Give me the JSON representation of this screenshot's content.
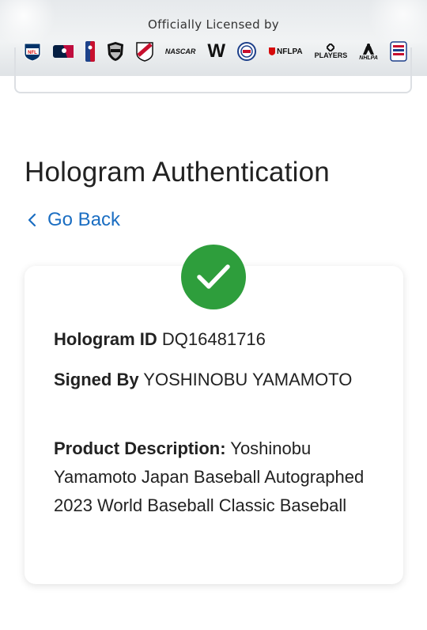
{
  "banner": {
    "title": "Officially Licensed by",
    "logos": [
      {
        "name": "nfl-logo",
        "label": "NFL"
      },
      {
        "name": "mlb-logo",
        "label": ""
      },
      {
        "name": "nba-logo",
        "label": ""
      },
      {
        "name": "nhl-logo",
        "label": ""
      },
      {
        "name": "mls-logo",
        "label": ""
      },
      {
        "name": "nascar-logo",
        "label": "NASCAR"
      },
      {
        "name": "wwe-logo",
        "label": "W"
      },
      {
        "name": "usa-logo",
        "label": ""
      },
      {
        "name": "nflpa-logo",
        "label": "NFLPA"
      },
      {
        "name": "players-logo",
        "label": "PLAYERS"
      },
      {
        "name": "nhlpa-logo",
        "label": "NHLPA"
      },
      {
        "name": "hof-logo",
        "label": ""
      }
    ]
  },
  "page": {
    "title": "Hologram Authentication",
    "back_label": "Go Back"
  },
  "result": {
    "status_icon": "check-icon",
    "status_color": "#2e9e3c",
    "hologram_label": "Hologram ID",
    "hologram_value": "DQ16481716",
    "signed_label": "Signed By",
    "signed_value": "YOSHINOBU YAMAMOTO",
    "description_label": "Product Description:",
    "description_value": "Yoshinobu Yamamoto Japan Baseball Autographed 2023 World Baseball Classic Baseball"
  },
  "colors": {
    "link": "#1b6ec2",
    "success": "#2e9e3c"
  }
}
